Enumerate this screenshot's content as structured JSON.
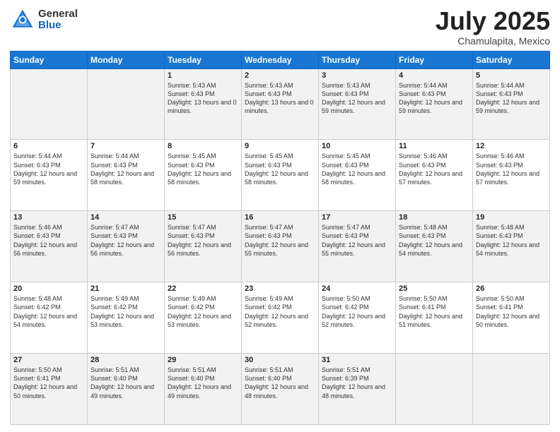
{
  "header": {
    "logo_general": "General",
    "logo_blue": "Blue",
    "month_title": "July 2025",
    "location": "Chamulapita, Mexico"
  },
  "days_of_week": [
    "Sunday",
    "Monday",
    "Tuesday",
    "Wednesday",
    "Thursday",
    "Friday",
    "Saturday"
  ],
  "weeks": [
    [
      {
        "day": "",
        "sunrise": "",
        "sunset": "",
        "daylight": ""
      },
      {
        "day": "",
        "sunrise": "",
        "sunset": "",
        "daylight": ""
      },
      {
        "day": "1",
        "sunrise": "Sunrise: 5:43 AM",
        "sunset": "Sunset: 6:43 PM",
        "daylight": "Daylight: 13 hours and 0 minutes."
      },
      {
        "day": "2",
        "sunrise": "Sunrise: 5:43 AM",
        "sunset": "Sunset: 6:43 PM",
        "daylight": "Daylight: 13 hours and 0 minutes."
      },
      {
        "day": "3",
        "sunrise": "Sunrise: 5:43 AM",
        "sunset": "Sunset: 6:43 PM",
        "daylight": "Daylight: 12 hours and 59 minutes."
      },
      {
        "day": "4",
        "sunrise": "Sunrise: 5:44 AM",
        "sunset": "Sunset: 6:43 PM",
        "daylight": "Daylight: 12 hours and 59 minutes."
      },
      {
        "day": "5",
        "sunrise": "Sunrise: 5:44 AM",
        "sunset": "Sunset: 6:43 PM",
        "daylight": "Daylight: 12 hours and 59 minutes."
      }
    ],
    [
      {
        "day": "6",
        "sunrise": "Sunrise: 5:44 AM",
        "sunset": "Sunset: 6:43 PM",
        "daylight": "Daylight: 12 hours and 59 minutes."
      },
      {
        "day": "7",
        "sunrise": "Sunrise: 5:44 AM",
        "sunset": "Sunset: 6:43 PM",
        "daylight": "Daylight: 12 hours and 58 minutes."
      },
      {
        "day": "8",
        "sunrise": "Sunrise: 5:45 AM",
        "sunset": "Sunset: 6:43 PM",
        "daylight": "Daylight: 12 hours and 58 minutes."
      },
      {
        "day": "9",
        "sunrise": "Sunrise: 5:45 AM",
        "sunset": "Sunset: 6:43 PM",
        "daylight": "Daylight: 12 hours and 58 minutes."
      },
      {
        "day": "10",
        "sunrise": "Sunrise: 5:45 AM",
        "sunset": "Sunset: 6:43 PM",
        "daylight": "Daylight: 12 hours and 58 minutes."
      },
      {
        "day": "11",
        "sunrise": "Sunrise: 5:46 AM",
        "sunset": "Sunset: 6:43 PM",
        "daylight": "Daylight: 12 hours and 57 minutes."
      },
      {
        "day": "12",
        "sunrise": "Sunrise: 5:46 AM",
        "sunset": "Sunset: 6:43 PM",
        "daylight": "Daylight: 12 hours and 57 minutes."
      }
    ],
    [
      {
        "day": "13",
        "sunrise": "Sunrise: 5:46 AM",
        "sunset": "Sunset: 6:43 PM",
        "daylight": "Daylight: 12 hours and 56 minutes."
      },
      {
        "day": "14",
        "sunrise": "Sunrise: 5:47 AM",
        "sunset": "Sunset: 6:43 PM",
        "daylight": "Daylight: 12 hours and 56 minutes."
      },
      {
        "day": "15",
        "sunrise": "Sunrise: 5:47 AM",
        "sunset": "Sunset: 6:43 PM",
        "daylight": "Daylight: 12 hours and 56 minutes."
      },
      {
        "day": "16",
        "sunrise": "Sunrise: 5:47 AM",
        "sunset": "Sunset: 6:43 PM",
        "daylight": "Daylight: 12 hours and 55 minutes."
      },
      {
        "day": "17",
        "sunrise": "Sunrise: 5:47 AM",
        "sunset": "Sunset: 6:43 PM",
        "daylight": "Daylight: 12 hours and 55 minutes."
      },
      {
        "day": "18",
        "sunrise": "Sunrise: 5:48 AM",
        "sunset": "Sunset: 6:43 PM",
        "daylight": "Daylight: 12 hours and 54 minutes."
      },
      {
        "day": "19",
        "sunrise": "Sunrise: 5:48 AM",
        "sunset": "Sunset: 6:43 PM",
        "daylight": "Daylight: 12 hours and 54 minutes."
      }
    ],
    [
      {
        "day": "20",
        "sunrise": "Sunrise: 5:48 AM",
        "sunset": "Sunset: 6:42 PM",
        "daylight": "Daylight: 12 hours and 54 minutes."
      },
      {
        "day": "21",
        "sunrise": "Sunrise: 5:49 AM",
        "sunset": "Sunset: 6:42 PM",
        "daylight": "Daylight: 12 hours and 53 minutes."
      },
      {
        "day": "22",
        "sunrise": "Sunrise: 5:49 AM",
        "sunset": "Sunset: 6:42 PM",
        "daylight": "Daylight: 12 hours and 53 minutes."
      },
      {
        "day": "23",
        "sunrise": "Sunrise: 5:49 AM",
        "sunset": "Sunset: 6:42 PM",
        "daylight": "Daylight: 12 hours and 52 minutes."
      },
      {
        "day": "24",
        "sunrise": "Sunrise: 5:50 AM",
        "sunset": "Sunset: 6:42 PM",
        "daylight": "Daylight: 12 hours and 52 minutes."
      },
      {
        "day": "25",
        "sunrise": "Sunrise: 5:50 AM",
        "sunset": "Sunset: 6:41 PM",
        "daylight": "Daylight: 12 hours and 51 minutes."
      },
      {
        "day": "26",
        "sunrise": "Sunrise: 5:50 AM",
        "sunset": "Sunset: 6:41 PM",
        "daylight": "Daylight: 12 hours and 50 minutes."
      }
    ],
    [
      {
        "day": "27",
        "sunrise": "Sunrise: 5:50 AM",
        "sunset": "Sunset: 6:41 PM",
        "daylight": "Daylight: 12 hours and 50 minutes."
      },
      {
        "day": "28",
        "sunrise": "Sunrise: 5:51 AM",
        "sunset": "Sunset: 6:40 PM",
        "daylight": "Daylight: 12 hours and 49 minutes."
      },
      {
        "day": "29",
        "sunrise": "Sunrise: 5:51 AM",
        "sunset": "Sunset: 6:40 PM",
        "daylight": "Daylight: 12 hours and 49 minutes."
      },
      {
        "day": "30",
        "sunrise": "Sunrise: 5:51 AM",
        "sunset": "Sunset: 6:40 PM",
        "daylight": "Daylight: 12 hours and 48 minutes."
      },
      {
        "day": "31",
        "sunrise": "Sunrise: 5:51 AM",
        "sunset": "Sunset: 6:39 PM",
        "daylight": "Daylight: 12 hours and 48 minutes."
      },
      {
        "day": "",
        "sunrise": "",
        "sunset": "",
        "daylight": ""
      },
      {
        "day": "",
        "sunrise": "",
        "sunset": "",
        "daylight": ""
      }
    ]
  ],
  "shaded_rows": [
    0,
    2,
    4
  ]
}
